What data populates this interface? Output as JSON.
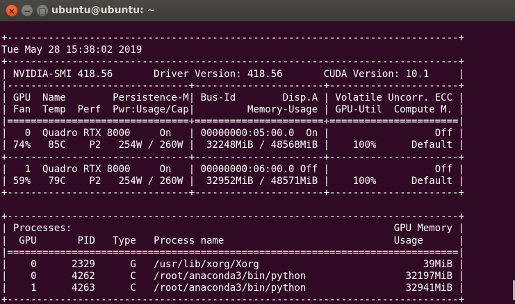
{
  "window": {
    "title": "ubuntu@ubuntu: ~",
    "close_icon": "×",
    "minimize_icon": "−",
    "maximize_icon": "□"
  },
  "terminal": {
    "lines": [
      "",
      "+-----------------------------------------------------------------------------+",
      "Tue May 28 15:38:02 2019",
      "+-----------------------------------------------------------------------------+",
      "| NVIDIA-SMI 418.56       Driver Version: 418.56       CUDA Version: 10.1     |",
      "|-------------------------------+----------------------+----------------------+",
      "| GPU  Name        Persistence-M| Bus-Id        Disp.A | Volatile Uncorr. ECC |",
      "| Fan  Temp  Perf  Pwr:Usage/Cap|         Memory-Usage | GPU-Util  Compute M. |",
      "|===============================+======================+======================|",
      "|   0  Quadro RTX 8000     On   | 00000000:05:00.0  On |                  Off |",
      "| 74%   85C    P2   254W / 260W |  32248MiB / 48568MiB |    100%      Default |",
      "+-------------------------------+----------------------+----------------------+",
      "|   1  Quadro RTX 8000     On   | 00000000:06:00.0 Off |                  Off |",
      "| 59%   79C    P2   254W / 260W |  32952MiB / 48571MiB |    100%      Default |",
      "+-------------------------------+----------------------+----------------------+",
      "",
      "+-----------------------------------------------------------------------------+",
      "| Processes:                                                       GPU Memory |",
      "|  GPU       PID   Type   Process name                             Usage      |",
      "|=============================================================================|",
      "|    0      2329      G   /usr/lib/xorg/Xorg                            39MiB |",
      "|    0      4262      C   /root/anaconda3/bin/python                 32197MiB |",
      "|    1      4263      C   /root/anaconda3/bin/python                 32941MiB |",
      "+-----------------------------------------------------------------------------+"
    ]
  }
}
